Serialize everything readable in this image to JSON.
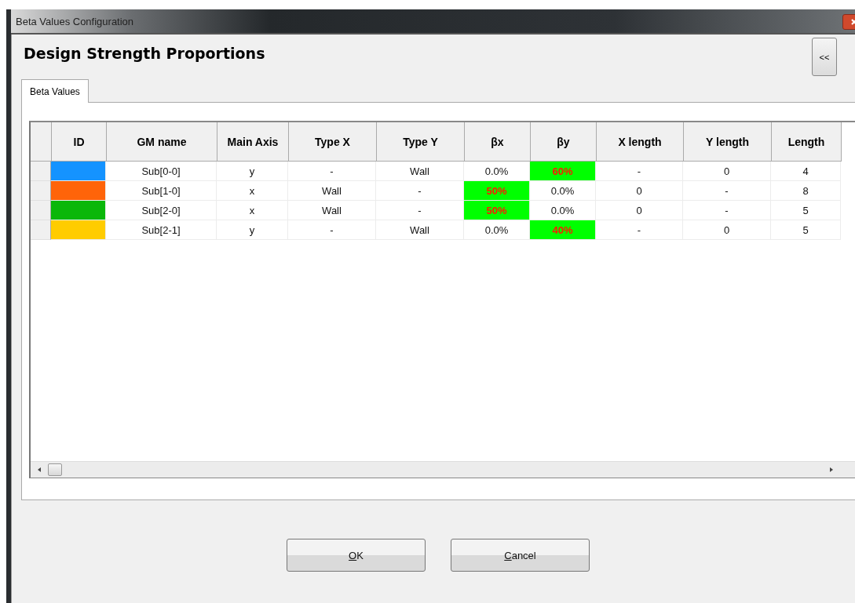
{
  "window": {
    "title": "Beta Values Configuration"
  },
  "heading": "Design Strength Proportions",
  "collapse_button": "<<",
  "tabs": [
    {
      "label": "Beta Values",
      "selected": true
    }
  ],
  "table": {
    "columns": [
      "ID",
      "GM name",
      "Main Axis",
      "Type X",
      "Type Y",
      "βx",
      "βy",
      "X length",
      "Y length",
      "Length"
    ],
    "rows": [
      {
        "color": "#1593ff",
        "gm_name": "Sub[0-0]",
        "main_axis": "y",
        "type_x": "-",
        "type_y": "Wall",
        "beta_x": {
          "text": "0.0%",
          "highlighted": false
        },
        "beta_y": {
          "text": "60%",
          "highlighted": true
        },
        "x_length": "-",
        "y_length": "0",
        "length": "4"
      },
      {
        "color": "#ff6409",
        "gm_name": "Sub[1-0]",
        "main_axis": "x",
        "type_x": "Wall",
        "type_y": "-",
        "beta_x": {
          "text": "50%",
          "highlighted": true
        },
        "beta_y": {
          "text": "0.0%",
          "highlighted": false
        },
        "x_length": "0",
        "y_length": "-",
        "length": "8"
      },
      {
        "color": "#0ab70a",
        "gm_name": "Sub[2-0]",
        "main_axis": "x",
        "type_x": "Wall",
        "type_y": "-",
        "beta_x": {
          "text": "50%",
          "highlighted": true
        },
        "beta_y": {
          "text": "0.0%",
          "highlighted": false
        },
        "x_length": "0",
        "y_length": "-",
        "length": "5"
      },
      {
        "color": "#ffcc00",
        "gm_name": "Sub[2-1]",
        "main_axis": "y",
        "type_x": "-",
        "type_y": "Wall",
        "beta_x": {
          "text": "0.0%",
          "highlighted": false
        },
        "beta_y": {
          "text": "40%",
          "highlighted": true
        },
        "x_length": "-",
        "y_length": "0",
        "length": "5"
      }
    ]
  },
  "buttons": [
    {
      "access_key": "O",
      "label_rest": "K"
    },
    {
      "access_key": "C",
      "label_rest": "ancel"
    }
  ]
}
